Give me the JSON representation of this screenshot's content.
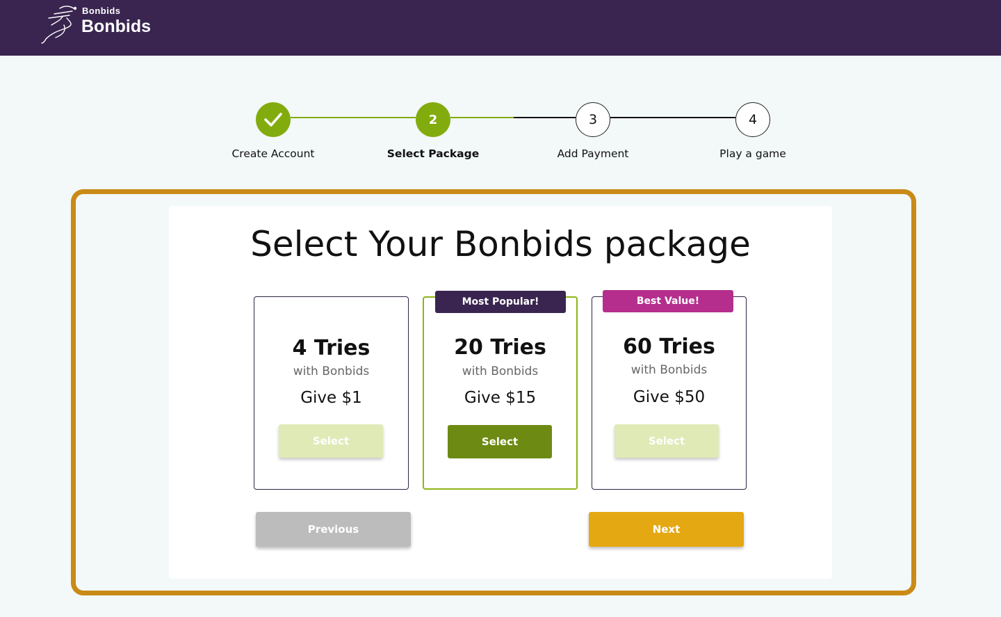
{
  "header": {
    "logo_small": "Bonbids",
    "logo_big": "Bonbids"
  },
  "stepper": {
    "steps": [
      {
        "number": "",
        "label": "Create Account",
        "state": "done"
      },
      {
        "number": "2",
        "label": "Select Package",
        "state": "active"
      },
      {
        "number": "3",
        "label": "Add Payment",
        "state": "todo"
      },
      {
        "number": "4",
        "label": "Play a game",
        "state": "todo"
      }
    ]
  },
  "main": {
    "title": "Select Your Bonbids package",
    "packages": [
      {
        "badge": "",
        "tries": "4 Tries",
        "sub": "with Bonbids",
        "price": "Give $1",
        "button": "Select",
        "selected": false
      },
      {
        "badge": "Most Popular!",
        "tries": "20 Tries",
        "sub": "with Bonbids",
        "price": "Give $15",
        "button": "Select",
        "selected": true
      },
      {
        "badge": "Best Value!",
        "tries": "60 Tries",
        "sub": "with Bonbids",
        "price": "Give $50",
        "button": "Select",
        "selected": false
      }
    ],
    "previous_label": "Previous",
    "next_label": "Next"
  },
  "colors": {
    "header_bg": "#392550",
    "accent_green": "#82ac0e",
    "select_active": "#6d8a13",
    "frame_border": "#c98a16",
    "next_button": "#e4a812",
    "badge_popular": "#392550",
    "badge_best_value": "#b52e8e"
  }
}
